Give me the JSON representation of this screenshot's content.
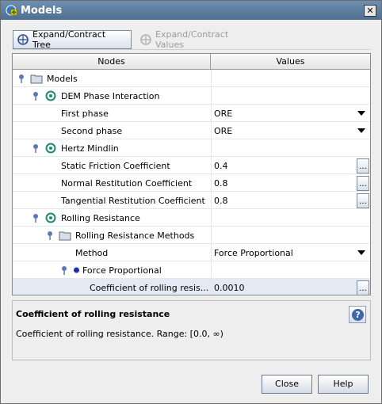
{
  "window": {
    "title": "Models"
  },
  "toolbar": {
    "expand_tree_label": "Expand/Contract Tree",
    "expand_values_label": "Expand/Contract Values"
  },
  "table": {
    "headers": {
      "nodes": "Nodes",
      "values": "Values"
    },
    "rows": [
      {
        "label": "Models",
        "value": "",
        "icon": "folder-icon",
        "pin": true
      },
      {
        "label": "DEM Phase Interaction",
        "value": "",
        "icon": "model-icon",
        "pin": true
      },
      {
        "label": "First phase",
        "value": "ORE",
        "control": "dropdown"
      },
      {
        "label": "Second phase",
        "value": "ORE",
        "control": "dropdown"
      },
      {
        "label": "Hertz Mindlin",
        "value": "",
        "icon": "model-icon",
        "pin": true
      },
      {
        "label": "Static Friction Coefficient",
        "value": "0.4",
        "control": "ellipsis"
      },
      {
        "label": "Normal Restitution Coefficient",
        "value": "0.8",
        "control": "ellipsis"
      },
      {
        "label": "Tangential Restitution Coefficient",
        "value": "0.8",
        "control": "ellipsis"
      },
      {
        "label": "Rolling Resistance",
        "value": "",
        "icon": "model-icon",
        "pin": true
      },
      {
        "label": "Rolling Resistance Methods",
        "value": "",
        "icon": "folder-icon",
        "pin": true
      },
      {
        "label": "Method",
        "value": "Force Proportional",
        "control": "dropdown"
      },
      {
        "label": "Force Proportional",
        "value": "",
        "icon": "dot-icon",
        "pin": true
      },
      {
        "label": "Coefficient of rolling resis...",
        "value": "0.0010",
        "control": "ellipsis",
        "selected": true
      }
    ]
  },
  "description": {
    "title": "Coefficient of rolling resistance",
    "text": "Coefficient of rolling resistance. Range: [0.0, ∞)"
  },
  "buttons": {
    "close_label": "Close",
    "help_label": "Help"
  },
  "colors": {
    "titlebar": "#5f7fa0",
    "selection": "#e4eaf3",
    "help_blue": "#3d67a8",
    "model_green": "#1f8a6a"
  }
}
